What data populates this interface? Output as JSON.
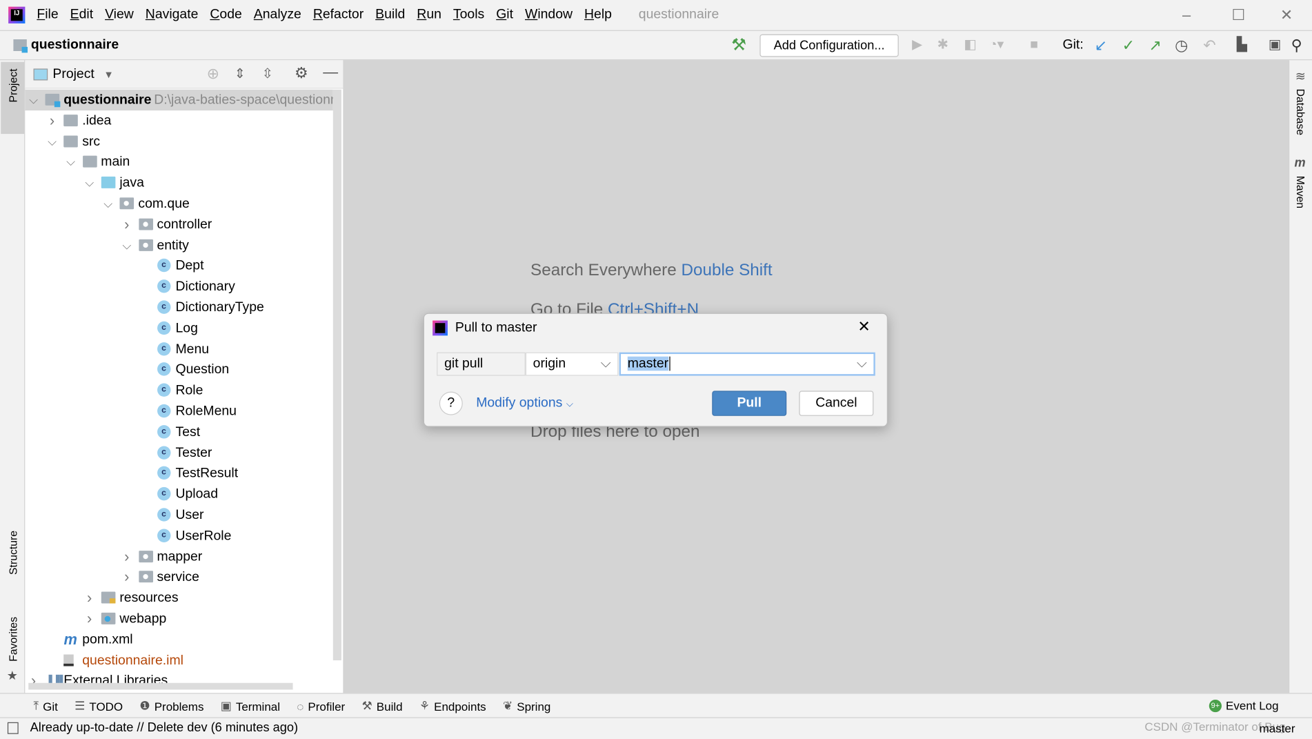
{
  "menu": {
    "items": [
      "File",
      "Edit",
      "View",
      "Navigate",
      "Code",
      "Analyze",
      "Refactor",
      "Build",
      "Run",
      "Tools",
      "Git",
      "Window",
      "Help"
    ],
    "window_title": "questionnaire"
  },
  "toolbar": {
    "project": "questionnaire",
    "add_configuration": "Add Configuration...",
    "git_label": "Git:"
  },
  "left_tabs": {
    "project": "Project",
    "structure": "Structure",
    "favorites": "Favorites"
  },
  "right_tabs": {
    "database": "Database",
    "maven": "Maven"
  },
  "panel": {
    "title": "Project",
    "tree": [
      {
        "label": "questionnaire",
        "path": "D:\\java-baties-space\\questionn",
        "level": 0,
        "state": "expanded",
        "icon": "module",
        "bold": true,
        "selected": true
      },
      {
        "label": ".idea",
        "level": 1,
        "state": "collapsed",
        "icon": "folder"
      },
      {
        "label": "src",
        "level": 1,
        "state": "expanded",
        "icon": "folder"
      },
      {
        "label": "main",
        "level": 2,
        "state": "expanded",
        "icon": "folder"
      },
      {
        "label": "java",
        "level": 3,
        "state": "expanded",
        "icon": "source-folder"
      },
      {
        "label": "com.que",
        "level": 4,
        "state": "expanded",
        "icon": "package"
      },
      {
        "label": "controller",
        "level": 5,
        "state": "collapsed",
        "icon": "package"
      },
      {
        "label": "entity",
        "level": 5,
        "state": "expanded",
        "icon": "package"
      },
      {
        "label": "Dept",
        "level": 6,
        "icon": "class"
      },
      {
        "label": "Dictionary",
        "level": 6,
        "icon": "class"
      },
      {
        "label": "DictionaryType",
        "level": 6,
        "icon": "class"
      },
      {
        "label": "Log",
        "level": 6,
        "icon": "class"
      },
      {
        "label": "Menu",
        "level": 6,
        "icon": "class"
      },
      {
        "label": "Question",
        "level": 6,
        "icon": "class"
      },
      {
        "label": "Role",
        "level": 6,
        "icon": "class"
      },
      {
        "label": "RoleMenu",
        "level": 6,
        "icon": "class"
      },
      {
        "label": "Test",
        "level": 6,
        "icon": "class"
      },
      {
        "label": "Tester",
        "level": 6,
        "icon": "class"
      },
      {
        "label": "TestResult",
        "level": 6,
        "icon": "class"
      },
      {
        "label": "Upload",
        "level": 6,
        "icon": "class"
      },
      {
        "label": "User",
        "level": 6,
        "icon": "class"
      },
      {
        "label": "UserRole",
        "level": 6,
        "icon": "class"
      },
      {
        "label": "mapper",
        "level": 5,
        "state": "collapsed",
        "icon": "package"
      },
      {
        "label": "service",
        "level": 5,
        "state": "collapsed",
        "icon": "package"
      },
      {
        "label": "resources",
        "level": 3,
        "state": "collapsed",
        "icon": "resources-folder"
      },
      {
        "label": "webapp",
        "level": 3,
        "state": "collapsed",
        "icon": "web-folder"
      },
      {
        "label": "pom.xml",
        "level": 1,
        "icon": "maven"
      },
      {
        "label": "questionnaire.iml",
        "level": 1,
        "icon": "iml",
        "color": "#b5480a"
      },
      {
        "label": "External Libraries",
        "level": 0,
        "state": "collapsed",
        "icon": "library"
      }
    ]
  },
  "editor": {
    "hints": [
      {
        "text": "Search Everywhere",
        "key": "Double Shift"
      },
      {
        "text": "Go to File",
        "key": "Ctrl+Shift+N"
      }
    ],
    "drop": "Drop files here to open"
  },
  "dialog": {
    "title": "Pull to master",
    "command": "git pull",
    "remote": "origin",
    "branch": "master",
    "modify_options": "Modify options",
    "pull": "Pull",
    "cancel": "Cancel",
    "help": "?"
  },
  "bottom_tabs": [
    "Git",
    "TODO",
    "Problems",
    "Terminal",
    "Profiler",
    "Build",
    "Endpoints",
    "Spring"
  ],
  "event_log": "Event Log",
  "status": {
    "message": "Already up-to-date // Delete dev (6 minutes ago)",
    "branch": "master",
    "watermark": "CSDN @Terminator of Bug"
  },
  "colors": {
    "accent": "#4a88c7",
    "link": "#2a6bc4",
    "selection": "#a6ccf4"
  }
}
